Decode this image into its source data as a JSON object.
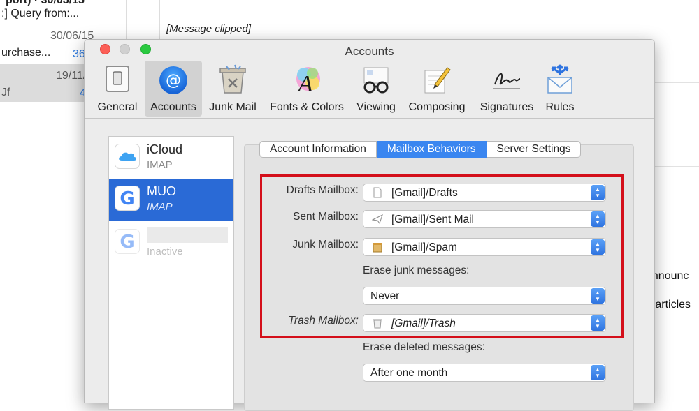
{
  "background": {
    "list_rows": [
      {
        "text": "port) · 30/05/15",
        "sub": ":] Query from:..."
      },
      {
        "date": "30/06/15",
        "text": "urchase...",
        "count": "36"
      },
      {
        "date": "19/11/",
        "text": "Jf",
        "count": "4"
      }
    ],
    "message_clipped": "[Message clipped]",
    "fragment_1": "announc",
    "fragment_2": "h articles"
  },
  "window": {
    "title": "Accounts",
    "toolbar": [
      {
        "label": "General",
        "icon": "general-icon"
      },
      {
        "label": "Accounts",
        "icon": "at-sign-icon",
        "selected": true
      },
      {
        "label": "Junk Mail",
        "icon": "junk-bin-icon"
      },
      {
        "label": "Fonts & Colors",
        "icon": "fonts-colors-icon"
      },
      {
        "label": "Viewing",
        "icon": "glasses-icon"
      },
      {
        "label": "Composing",
        "icon": "pencil-note-icon"
      },
      {
        "label": "Signatures",
        "icon": "signature-icon"
      },
      {
        "label": "Rules",
        "icon": "rules-envelope-icon"
      }
    ]
  },
  "accounts": [
    {
      "name": "iCloud",
      "type": "IMAP",
      "icon": "icloud-icon"
    },
    {
      "name": "MUO",
      "type": "IMAP",
      "icon": "google-icon",
      "selected": true
    },
    {
      "name": "",
      "type": "Inactive",
      "icon": "google-icon"
    }
  ],
  "tabs": [
    {
      "label": "Account Information"
    },
    {
      "label": "Mailbox Behaviors",
      "selected": true
    },
    {
      "label": "Server Settings"
    }
  ],
  "mailbox": {
    "drafts_label": "Drafts Mailbox:",
    "drafts_value": "[Gmail]/Drafts",
    "sent_label": "Sent Mailbox:",
    "sent_value": "[Gmail]/Sent Mail",
    "junk_label": "Junk Mailbox:",
    "junk_value": "[Gmail]/Spam",
    "erase_junk_label": "Erase junk messages:",
    "erase_junk_value": "Never",
    "trash_label": "Trash Mailbox:",
    "trash_value": "[Gmail]/Trash",
    "erase_deleted_label": "Erase deleted messages:",
    "erase_deleted_value": "After one month"
  },
  "colors": {
    "accent": "#3a86f0",
    "selection": "#2a6ad6",
    "highlight_box": "#d40f1a"
  }
}
